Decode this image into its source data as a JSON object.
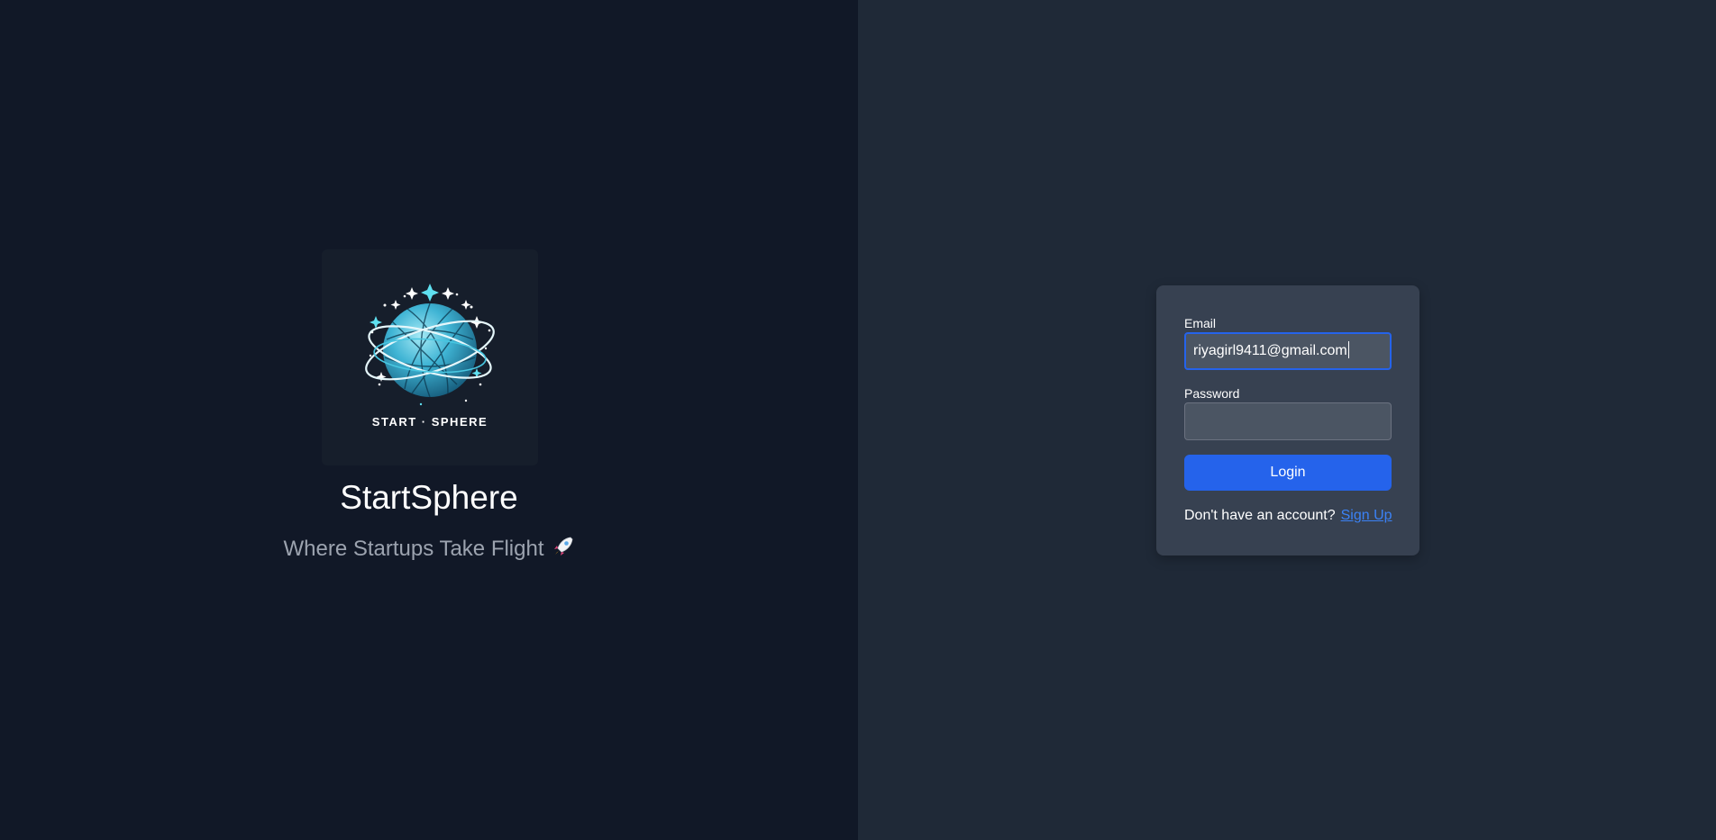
{
  "brand": {
    "logo_text": "START · SPHERE",
    "name": "StartSphere",
    "tagline": "Where Startups Take Flight",
    "tagline_icon": "rocket-icon"
  },
  "login_form": {
    "email_label": "Email",
    "email_value": "riyagirl9411@gmail.com",
    "password_label": "Password",
    "password_value": "",
    "login_button": "Login",
    "signup_prompt": "Don't have an account?",
    "signup_link": "Sign Up"
  },
  "colors": {
    "left_bg": "#111827",
    "right_bg": "#1f2937",
    "card_bg": "#374151",
    "accent": "#2563eb",
    "link": "#3b82f6"
  }
}
